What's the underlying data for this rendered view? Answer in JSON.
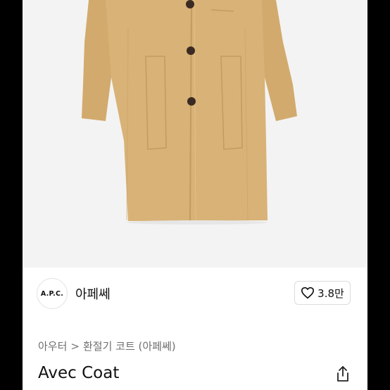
{
  "product": {
    "image_alt": "Avec Coat",
    "title": "Avec Coat"
  },
  "brand": {
    "logo_text": "A.P.C.",
    "name": "아페쎄",
    "like_count": "3.8만",
    "like_icon": "heart-outline-icon"
  },
  "breadcrumb": {
    "items": [
      "아우터",
      "환절기 코트 (아페쎄)"
    ],
    "separator": ">"
  },
  "actions": {
    "share_icon": "share-icon"
  },
  "colors": {
    "page_bg": "#ffffff",
    "hero_bg": "#f3f3f3",
    "coat": "#d8b277",
    "border": "#dcdcdc",
    "muted_text": "#6f6f6f"
  }
}
